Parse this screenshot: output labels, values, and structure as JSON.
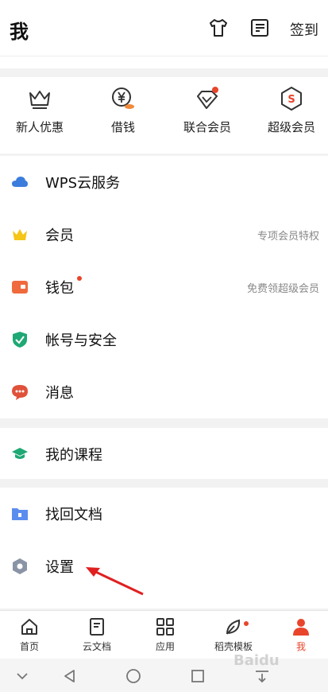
{
  "header": {
    "title": "我",
    "sign_in": "签到",
    "icons": [
      "tshirt-icon",
      "checklist-icon"
    ]
  },
  "quick_actions": [
    {
      "label": "新人优惠",
      "icon": "crown-outline-icon"
    },
    {
      "label": "借钱",
      "icon": "yen-coin-icon"
    },
    {
      "label": "联合会员",
      "icon": "joint-member-diamond-icon"
    },
    {
      "label": "超级会员",
      "icon": "super-member-hexagon-icon"
    }
  ],
  "menu": {
    "cloud": {
      "label": "WPS云服务"
    },
    "member": {
      "label": "会员",
      "hint": "专项会员特权"
    },
    "wallet": {
      "label": "钱包",
      "hint": "免费领超级会员"
    },
    "security": {
      "label": "帐号与安全"
    },
    "messages": {
      "label": "消息"
    },
    "courses": {
      "label": "我的课程"
    },
    "recover": {
      "label": "找回文档"
    },
    "settings": {
      "label": "设置"
    }
  },
  "tabs": [
    {
      "label": "首页"
    },
    {
      "label": "云文档"
    },
    {
      "label": "应用"
    },
    {
      "label": "稻壳模板"
    },
    {
      "label": "我"
    }
  ],
  "watermark": "Baidu",
  "colors": {
    "accent": "#e8452c",
    "cloud": "#3b7ddd",
    "crown": "#f5c518",
    "wallet": "#ef6a3c",
    "shield": "#1ea874",
    "message": "#e0513a",
    "course": "#1ea874",
    "folder": "#5b8def",
    "gear": "#8a94a6"
  }
}
